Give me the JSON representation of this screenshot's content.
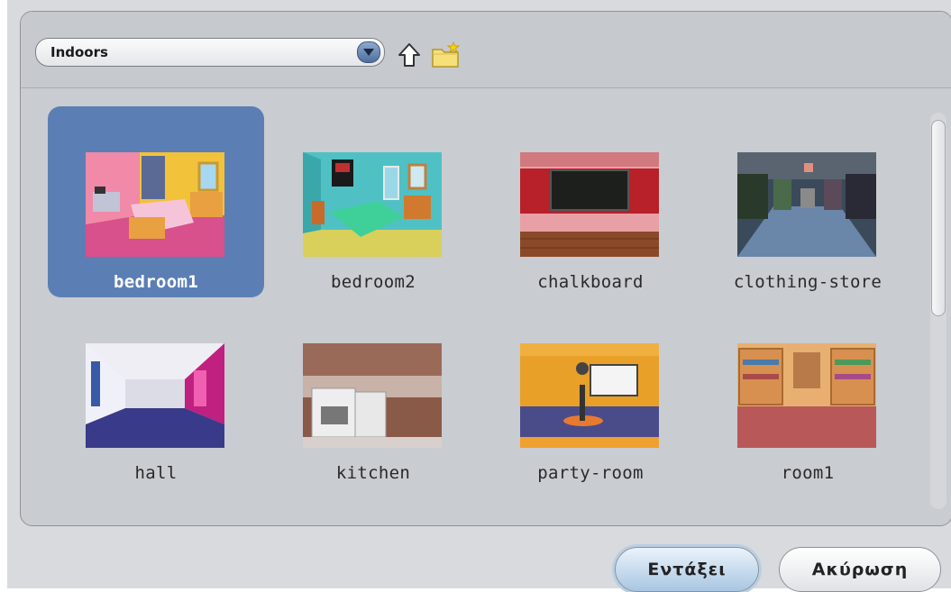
{
  "toolbar": {
    "category_value": "Indoors",
    "up_icon": "arrow-up-icon",
    "new_folder_icon": "new-folder-icon"
  },
  "items": [
    {
      "label": "bedroom1",
      "selected": true
    },
    {
      "label": "bedroom2",
      "selected": false
    },
    {
      "label": "chalkboard",
      "selected": false
    },
    {
      "label": "clothing-store",
      "selected": false
    },
    {
      "label": "hall",
      "selected": false
    },
    {
      "label": "kitchen",
      "selected": false
    },
    {
      "label": "party-room",
      "selected": false
    },
    {
      "label": "room1",
      "selected": false
    }
  ],
  "buttons": {
    "ok_label": "Εντάξει",
    "cancel_label": "Ακύρωση"
  },
  "colors": {
    "selection": "#5b7fb4",
    "panel": "#c9ccd0"
  }
}
